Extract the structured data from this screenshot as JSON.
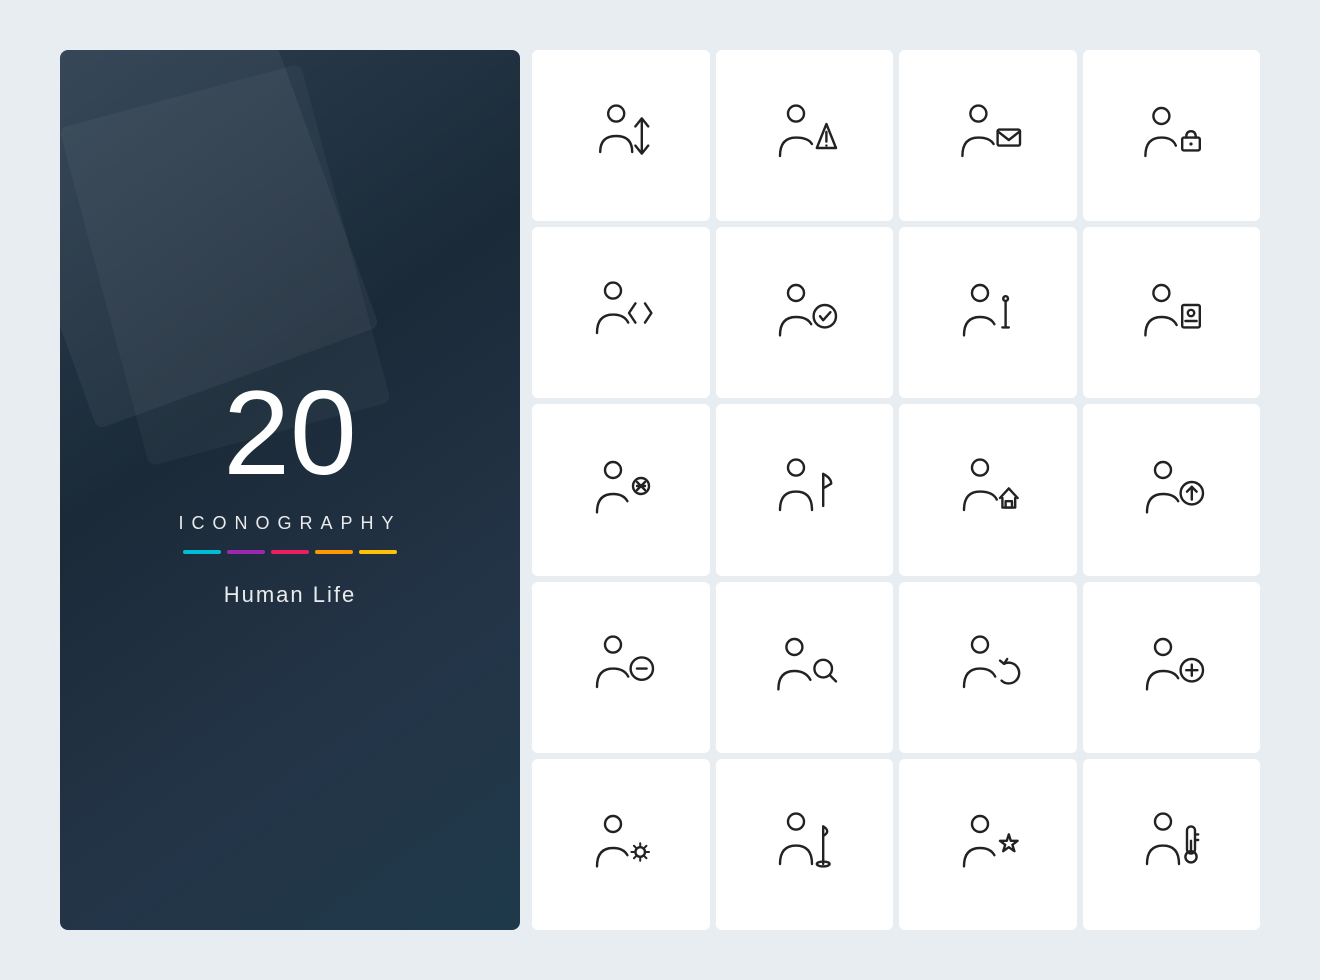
{
  "left": {
    "number": "20",
    "iconography": "ICONOGRAPHY",
    "title": "Human Life",
    "colors": [
      "#00bcd4",
      "#9c27b0",
      "#e91e63",
      "#ff9800",
      "#ffc107"
    ]
  },
  "icons": [
    {
      "id": "person-sort",
      "label": "Person with sort arrows"
    },
    {
      "id": "person-warning",
      "label": "Person with warning"
    },
    {
      "id": "person-mail",
      "label": "Person with mail"
    },
    {
      "id": "person-lock",
      "label": "Person with lock"
    },
    {
      "id": "person-code",
      "label": "Person with code"
    },
    {
      "id": "person-check",
      "label": "Person with checkmark"
    },
    {
      "id": "person-edit",
      "label": "Person with pencil"
    },
    {
      "id": "person-id",
      "label": "Person with ID card"
    },
    {
      "id": "person-remove",
      "label": "Person with X"
    },
    {
      "id": "person-flag",
      "label": "Person with flag"
    },
    {
      "id": "person-home",
      "label": "Person with home"
    },
    {
      "id": "person-upload",
      "label": "Person with upload"
    },
    {
      "id": "person-minus",
      "label": "Person with minus"
    },
    {
      "id": "person-search",
      "label": "Person with search"
    },
    {
      "id": "person-refresh",
      "label": "Person with refresh"
    },
    {
      "id": "person-add",
      "label": "Person with plus"
    },
    {
      "id": "person-settings",
      "label": "Person with settings"
    },
    {
      "id": "person-golf",
      "label": "Person with golf flag"
    },
    {
      "id": "person-star",
      "label": "Person with star"
    },
    {
      "id": "person-thermometer",
      "label": "Person with thermometer"
    }
  ]
}
